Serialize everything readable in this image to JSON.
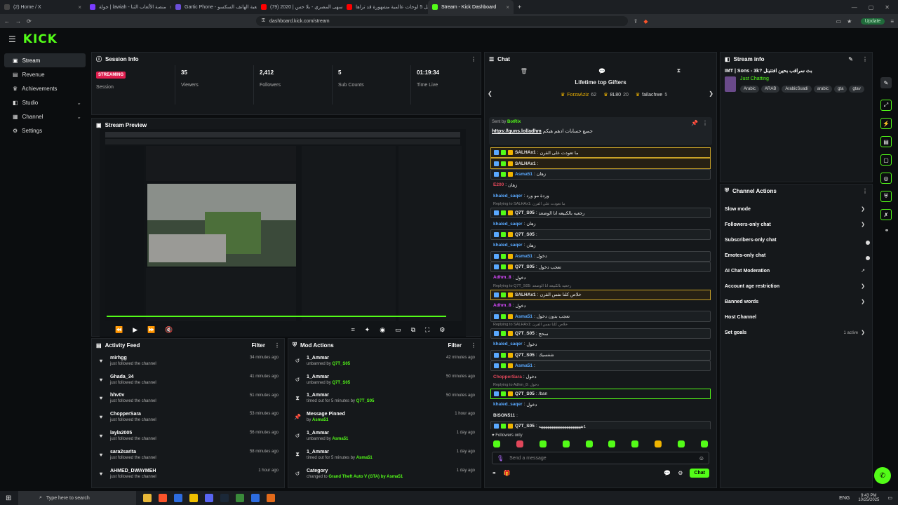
{
  "browser": {
    "tabs": [
      {
        "label": "(2) Home / X",
        "color": "#444"
      },
      {
        "label": "جولة | lawiah - منصة الألعاب الثنا",
        "color": "#7a3cff"
      },
      {
        "label": "Gartic Phone - لعبة الهاتف السكسو",
        "color": "#6b4fd8"
      },
      {
        "label": "(79) سهى المصري - بلا حس | 2020 | (",
        "color": "#ff0000"
      },
      {
        "label": "أجمل 5 لوحات عالمية مشهورة قد تراها",
        "color": "#ff0000"
      },
      {
        "label": "Stream - Kick Dashboard",
        "color": "#53fc18"
      }
    ],
    "url": "dashboard.kick.com/stream",
    "update_label": "Update"
  },
  "brand": {
    "logo": "KICK",
    "accent": "#53fc18"
  },
  "sidebar": {
    "items": [
      {
        "label": "Stream",
        "icon": "stream-icon"
      },
      {
        "label": "Revenue",
        "icon": "revenue-icon"
      },
      {
        "label": "Achievements",
        "icon": "trophy-icon"
      },
      {
        "label": "Studio",
        "icon": "studio-icon"
      },
      {
        "label": "Channel",
        "icon": "channel-icon"
      },
      {
        "label": "Settings",
        "icon": "gear-icon"
      }
    ]
  },
  "session": {
    "title": "Session Info",
    "badge": "STREAMING",
    "session_label": "Session",
    "stats": [
      {
        "value": "35",
        "label": "Viewers"
      },
      {
        "value": "2,412",
        "label": "Followers"
      },
      {
        "value": "5",
        "label": "Sub Counts"
      },
      {
        "value": "01:19:34",
        "label": "Time Live"
      }
    ]
  },
  "preview": {
    "title": "Stream Preview",
    "progress": 0.96
  },
  "activity": {
    "title": "Activity Feed",
    "filter": "Filter",
    "items": [
      {
        "name": "mirhgg",
        "sub": "just followed the channel",
        "time": "34 minutes ago"
      },
      {
        "name": "Ghada_34",
        "sub": "just followed the channel",
        "time": "41 minutes ago"
      },
      {
        "name": "hhv0v",
        "sub": "just followed the channel",
        "time": "51 minutes ago"
      },
      {
        "name": "ChopperSara",
        "sub": "just followed the channel",
        "time": "53 minutes ago"
      },
      {
        "name": "layla2005",
        "sub": "just followed the channel",
        "time": "56 minutes ago"
      },
      {
        "name": "sara2sarita",
        "sub": "just followed the channel",
        "time": "58 minutes ago"
      },
      {
        "name": "AHMED_DWAYMEH",
        "sub": "just followed the channel",
        "time": "1 hour ago"
      }
    ]
  },
  "mod": {
    "title": "Mod Actions",
    "filter": "Filter",
    "items": [
      {
        "icon": "undo-icon",
        "name": "1_Ammar",
        "pre": "unbanned by",
        "by": "Q7T_S05",
        "time": "42 minutes ago"
      },
      {
        "icon": "undo-icon",
        "name": "1_Ammar",
        "pre": "unbanned by",
        "by": "Q7T_S05",
        "time": "50 minutes ago"
      },
      {
        "icon": "hourglass-icon",
        "name": "1_Ammar",
        "pre": "timed out for 5 minutes by",
        "by": "Q7T_S05",
        "time": "50 minutes ago"
      },
      {
        "icon": "pin-icon",
        "name": "Message Pinned",
        "pre": "by",
        "by": "Asma51",
        "time": "1 hour ago"
      },
      {
        "icon": "undo-icon",
        "name": "1_Ammar",
        "pre": "unbanned by",
        "by": "Asma51",
        "time": "1 day ago"
      },
      {
        "icon": "hourglass-icon",
        "name": "1_Ammar",
        "pre": "timed out for 5 minutes by",
        "by": "Asma51",
        "time": "1 day ago"
      },
      {
        "icon": "undo-icon",
        "name": "Category",
        "pre": "changed to",
        "by": "Grand Theft Auto V (GTA) by Asma51",
        "time": "1 day ago"
      }
    ]
  },
  "chat": {
    "title": "Chat",
    "gifters_title": "Lifetime top Gifters",
    "gifters": [
      {
        "name": "ForzaAziz",
        "count": "62"
      },
      {
        "name": "8L80",
        "count": "20"
      },
      {
        "name": "failachwe",
        "count": "5"
      }
    ],
    "pinned_by_label": "Sent by",
    "pinned_by": "BotRix",
    "pinned_link": "https://guns.lol/adhm",
    "pinned_text": "جميع حسابات ادهم هيكم",
    "messages": [
      {
        "user": "SALHAx1",
        "color": "#e8e8e8",
        "text": "ما تعودت على القرن",
        "style": "mod"
      },
      {
        "user": "SALHAx1",
        "color": "#e8e8e8",
        "text": "",
        "style": "mod"
      },
      {
        "user": "Asma51",
        "color": "#5aa9ff",
        "text": "زهان",
        "style": "hl"
      },
      {
        "user": "E200",
        "color": "#e0475a",
        "text": "زهان",
        "style": ""
      },
      {
        "user": "khaled_saqer",
        "color": "#5aa9ff",
        "text": "وردة مو ورد",
        "style": ""
      },
      {
        "user": "Q7T_S05",
        "color": "#e8e8e8",
        "text": "رجعيه بالكبيعه انا الوضعد",
        "style": "hl",
        "reply": "Replying to SALHAx1: ما تعودت على القرن"
      },
      {
        "user": "khaled_saqer",
        "color": "#5aa9ff",
        "text": "زهان",
        "style": ""
      },
      {
        "user": "Q7T_S05",
        "color": "#e8e8e8",
        "text": "",
        "style": "hl"
      },
      {
        "user": "khaled_saqer",
        "color": "#5aa9ff",
        "text": "زهان",
        "style": ""
      },
      {
        "user": "Asma51",
        "color": "#5aa9ff",
        "text": "دخول",
        "style": "hl"
      },
      {
        "user": "Q7T_S05",
        "color": "#e8e8e8",
        "text": "تعجب دخول",
        "style": "hl"
      },
      {
        "user": "Adhm_8",
        "color": "#d94aff",
        "text": "دخول",
        "style": ""
      },
      {
        "user": "SALHAx1",
        "color": "#e8e8e8",
        "text": "خلاص كلنا نفس القرن",
        "style": "mod",
        "reply": "Replying to Q7T_S05: رجعيه بالكبيعه انا الوضعد"
      },
      {
        "user": "Adhm_8",
        "color": "#d94aff",
        "text": "دخول",
        "style": ""
      },
      {
        "user": "Asma51",
        "color": "#5aa9ff",
        "text": "تعجب بدون دخول",
        "style": "hl"
      },
      {
        "user": "Q7T_S05",
        "color": "#e8e8e8",
        "text": "سحج",
        "style": "hl",
        "reply": "Replying to SALHAx1: خلاص كلنا نفس القرن"
      },
      {
        "user": "khaled_saqer",
        "color": "#5aa9ff",
        "text": "دخول",
        "style": ""
      },
      {
        "user": "Q7T_S05",
        "color": "#e8e8e8",
        "text": "شفسيك",
        "style": "hl"
      },
      {
        "user": "Asma51",
        "color": "#5aa9ff",
        "text": "",
        "style": "hl"
      },
      {
        "user": "ChopperSara",
        "color": "#e0475a",
        "text": "دخول",
        "style": ""
      },
      {
        "user": "Q7T_S05",
        "color": "#e8e8e8",
        "text": "/ban",
        "style": "ban",
        "reply": "Replying to Adhm_8: دخول"
      },
      {
        "user": "khaled_saqer",
        "color": "#5aa9ff",
        "text": "دخول",
        "style": ""
      },
      {
        "user": "BISON511",
        "color": "#e8e8e8",
        "text": "",
        "style": ""
      },
      {
        "user": "Q7T_S05",
        "color": "#e8e8e8",
        "text": "٤ههههههههههههههههههههه",
        "style": "hl"
      }
    ],
    "followers_only": "Followers only",
    "placeholder": "Send a message",
    "send_label": "Chat"
  },
  "stream_info": {
    "title": "Stream info",
    "stream_title": "IMT | Sons - 3k? بث سراقب بحين افتتيتل",
    "category": "Just Chatting",
    "tags": [
      "Arabic",
      "ARAB",
      "ArabicSuadi",
      "arabic",
      "gta",
      "gtav"
    ]
  },
  "channel_actions": {
    "title": "Channel Actions",
    "items": [
      {
        "label": "Slow mode",
        "control": "chevron"
      },
      {
        "label": "Followers-only chat",
        "control": "chevron"
      },
      {
        "label": "Subscribers-only chat",
        "control": "toggle"
      },
      {
        "label": "Emotes-only chat",
        "control": "toggle"
      },
      {
        "label": "AI Chat Moderation",
        "control": "external"
      },
      {
        "label": "Account age restriction",
        "control": "chevron"
      },
      {
        "label": "Banned words",
        "control": "chevron"
      },
      {
        "label": "Host Channel",
        "control": "none"
      },
      {
        "label": "Set goals",
        "control": "chevron",
        "status": "1 active"
      }
    ]
  },
  "taskbar": {
    "search_placeholder": "Type here to search",
    "lang": "ENG",
    "time": "9:43 PM",
    "date": "10/25/2025"
  }
}
